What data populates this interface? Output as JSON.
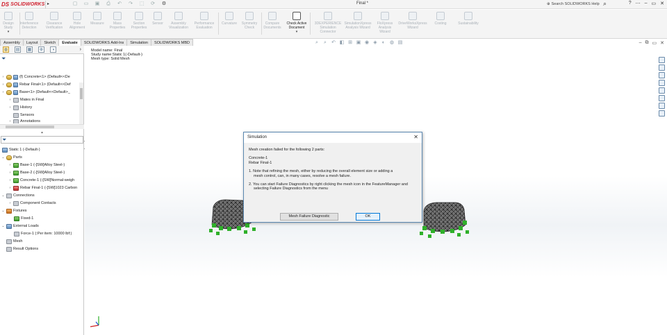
{
  "app": {
    "name": "SOLIDWORKS",
    "document_title": "Final *",
    "search_placeholder": "Search SOLIDWORKS Help"
  },
  "ribbon": {
    "items": [
      {
        "label1": "Design",
        "label2": "Study"
      },
      {
        "label1": "Interference",
        "label2": "Detection"
      },
      {
        "label1": "Clearance",
        "label2": "Verification"
      },
      {
        "label1": "Hole",
        "label2": "Alignment"
      },
      {
        "label1": "Measure",
        "label2": ""
      },
      {
        "label1": "Mass",
        "label2": "Properties"
      },
      {
        "label1": "Section",
        "label2": "Properties"
      },
      {
        "label1": "Sensor",
        "label2": ""
      },
      {
        "label1": "Assembly",
        "label2": "Visualization"
      },
      {
        "label1": "Performance",
        "label2": "Evaluation"
      },
      {
        "label1": "Curvature",
        "label2": ""
      },
      {
        "label1": "Symmetry",
        "label2": "Check"
      },
      {
        "label1": "Compare",
        "label2": "Documents"
      },
      {
        "label1": "Check Active",
        "label2": "Document"
      },
      {
        "label1": "3DEXPERIENCE",
        "label2": "Simulation",
        "label3": "Connector"
      },
      {
        "label1": "SimulationXpress",
        "label2": "Analysis Wizard"
      },
      {
        "label1": "FloXpress",
        "label2": "Analysis",
        "label3": "Wizard"
      },
      {
        "label1": "DriveWorksXpress",
        "label2": "Wizard"
      },
      {
        "label1": "Costing",
        "label2": ""
      },
      {
        "label1": "Sustainability",
        "label2": ""
      }
    ]
  },
  "tabs": [
    "Assembly",
    "Layout",
    "Sketch",
    "Evaluate",
    "SOLIDWORKS Add-Ins",
    "Simulation",
    "SOLIDWORKS MBD"
  ],
  "feature_tree": [
    {
      "label": "(f) Concrete<1> (Default<<De",
      "icon": "part-icon"
    },
    {
      "label": "Rebar Final<1> (Default<<Def",
      "icon": "part-icon"
    },
    {
      "label": "Base<1> (Default<<Default>_",
      "icon": "part-icon"
    },
    {
      "label": "Mates in Final",
      "icon": "mates-icon"
    },
    {
      "label": "History",
      "icon": "history-icon"
    },
    {
      "label": "Sensors",
      "icon": "sensors-icon"
    },
    {
      "label": "Annotations",
      "icon": "annotations-icon"
    }
  ],
  "simulation_tree": {
    "study": "Static 1 (-Default-)",
    "parts_label": "Parts",
    "parts": [
      "Base-1 (-[SW]Alloy Steel-)",
      "Base-2 (-[SW]Alloy Steel-)",
      "Concrete-1 (-[SW]Normal-weigh",
      "Rebar Final-1 (-[SW]1023 Carbon"
    ],
    "connections_label": "Connections",
    "connections": [
      "Component Contacts"
    ],
    "fixtures_label": "Fixtures",
    "fixtures": [
      "Fixed-1"
    ],
    "loads_label": "External Loads",
    "loads": [
      "Force-1 (:Per item: 10000 lbf:)"
    ],
    "mesh_label": "Mesh",
    "results_label": "Result Options"
  },
  "study_info": {
    "line1": "Model name: Final",
    "line2": "Study name:Static 1(-Default-)",
    "line3": "Mesh type: Solid Mesh"
  },
  "dialog": {
    "title": "Simulation",
    "heading": "Mesh creation failed for the following 2 parts:",
    "part1": "Concrete-1",
    "part2": "Rebar Final-1",
    "note1_a": "1. Note that refining the mesh, either by reducing the overall element size or adding a",
    "note1_b": "mesh control, can, in many cases, resolve a mesh failure.",
    "note2_a": "2. You can start Failure Diagnostics by right clicking the mesh icon in the FeatureManager and",
    "note2_b": "selecting Failure Diagnostics from the menu",
    "diag_button": "Mesh Failure Diagnostic",
    "ok_button": "OK"
  }
}
